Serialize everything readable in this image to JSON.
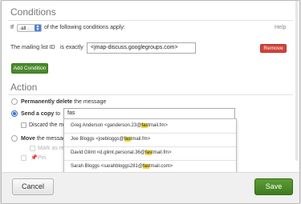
{
  "conditions": {
    "title": "Conditions",
    "if_label": "If",
    "match_value": "all",
    "suffix": "of the following conditions apply:",
    "help": "Help",
    "field_label": "The mailing list ID",
    "operator": "is exactly",
    "value": "<jmap-discuss.googlegroups.com>",
    "remove_label": "Remove",
    "add_label": "Add Condition"
  },
  "action": {
    "title": "Action",
    "delete_bold": "Permanently delete",
    "delete_rest": "the message",
    "send_bold": "Send a copy",
    "send_rest": "to",
    "send_input": "fas",
    "discard": "Discard the m",
    "move_bold": "Move",
    "move_rest": "the messag",
    "mark": "Mark as re",
    "pin": "Pin"
  },
  "suggestions": [
    {
      "pre": "Greg Anderson <ganderson.23@",
      "match": "fas",
      "post": "tmail.fm>"
    },
    {
      "pre": "Joe Bloggs <joebloggs@",
      "match": "fas",
      "post": "tmail.fm>"
    },
    {
      "pre": "David Glimt <d.glimt.personal.36@",
      "match": "fas",
      "post": "tmail.fm>"
    },
    {
      "pre": "Sarah Bloggs <sarahbloggs281@",
      "match": "fas",
      "post": "tmail.com>"
    }
  ],
  "footer": {
    "cancel": "Cancel",
    "save": "Save"
  }
}
